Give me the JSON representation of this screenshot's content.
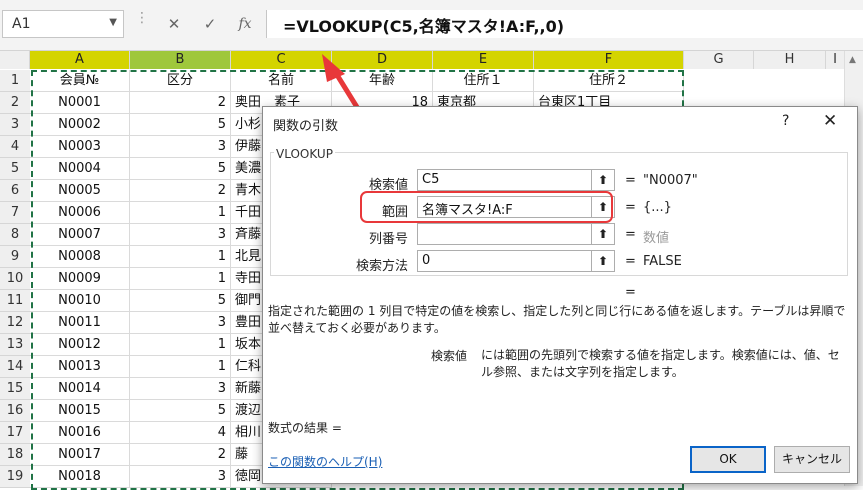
{
  "formula_bar": {
    "name_box": "A1",
    "cancel_icon": "cross-icon",
    "enter_icon": "check-icon",
    "fx_label": "fx",
    "formula": "=VLOOKUP(C5,名簿マスタ!A:F,,0)"
  },
  "columns": [
    "A",
    "B",
    "C",
    "D",
    "E",
    "F",
    "G",
    "H",
    "I"
  ],
  "rows": [
    "1",
    "2",
    "3",
    "4",
    "5",
    "6",
    "7",
    "8",
    "9",
    "10",
    "11",
    "12",
    "13",
    "14",
    "15",
    "16",
    "17",
    "18",
    "19"
  ],
  "header_row": [
    "会員№",
    "区分",
    "名前",
    "年齢",
    "住所１",
    "住所２"
  ],
  "row2": {
    "c": "奥田　素子",
    "d": "18",
    "e": "東京都",
    "f": "台東区1丁目"
  },
  "data": [
    {
      "id": "N0001",
      "k": "2",
      "name": "奥田"
    },
    {
      "id": "N0002",
      "k": "5",
      "name": "小杉"
    },
    {
      "id": "N0003",
      "k": "3",
      "name": "伊藤"
    },
    {
      "id": "N0004",
      "k": "5",
      "name": "美濃"
    },
    {
      "id": "N0005",
      "k": "2",
      "name": "青木"
    },
    {
      "id": "N0006",
      "k": "1",
      "name": "千田"
    },
    {
      "id": "N0007",
      "k": "3",
      "name": "斉藤"
    },
    {
      "id": "N0008",
      "k": "1",
      "name": "北見"
    },
    {
      "id": "N0009",
      "k": "1",
      "name": "寺田"
    },
    {
      "id": "N0010",
      "k": "5",
      "name": "御門"
    },
    {
      "id": "N0011",
      "k": "3",
      "name": "豊田"
    },
    {
      "id": "N0012",
      "k": "1",
      "name": "坂本"
    },
    {
      "id": "N0013",
      "k": "1",
      "name": "仁科"
    },
    {
      "id": "N0014",
      "k": "3",
      "name": "新藤"
    },
    {
      "id": "N0015",
      "k": "5",
      "name": "渡辺"
    },
    {
      "id": "N0016",
      "k": "4",
      "name": "相川"
    },
    {
      "id": "N0017",
      "k": "2",
      "name": "藤"
    },
    {
      "id": "N0018",
      "k": "3",
      "name": "徳岡"
    }
  ],
  "dialog": {
    "title": "関数の引数",
    "help": "?",
    "close": "✕",
    "function_name": "VLOOKUP",
    "args": [
      {
        "label": "検索値",
        "value": "C5",
        "result": "\"N0007\""
      },
      {
        "label": "範囲",
        "value": "名簿マスタ!A:F",
        "result": "{...}"
      },
      {
        "label": "列番号",
        "value": "",
        "result": "数値"
      },
      {
        "label": "検索方法",
        "value": "0",
        "result": "FALSE"
      }
    ],
    "equals": "=",
    "ref_icon": "collapse-arrow-icon",
    "description": "指定された範囲の 1 列目で特定の値を検索し、指定した列と同じ行にある値を返します。テーブルは昇順で並べ替えておく必要があります。",
    "arg_desc_label": "検索値",
    "arg_desc": "には範囲の先頭列で検索する値を指定します。検索値には、値、セル参照、または文字列を指定します。",
    "formula_result": "数式の結果 =",
    "help_link": "この関数のヘルプ(H)",
    "ok": "OK",
    "cancel": "キャンセル"
  },
  "colors": {
    "accent": "#217346",
    "highlight": "#e8383a",
    "selected_col": "#d4d400"
  }
}
